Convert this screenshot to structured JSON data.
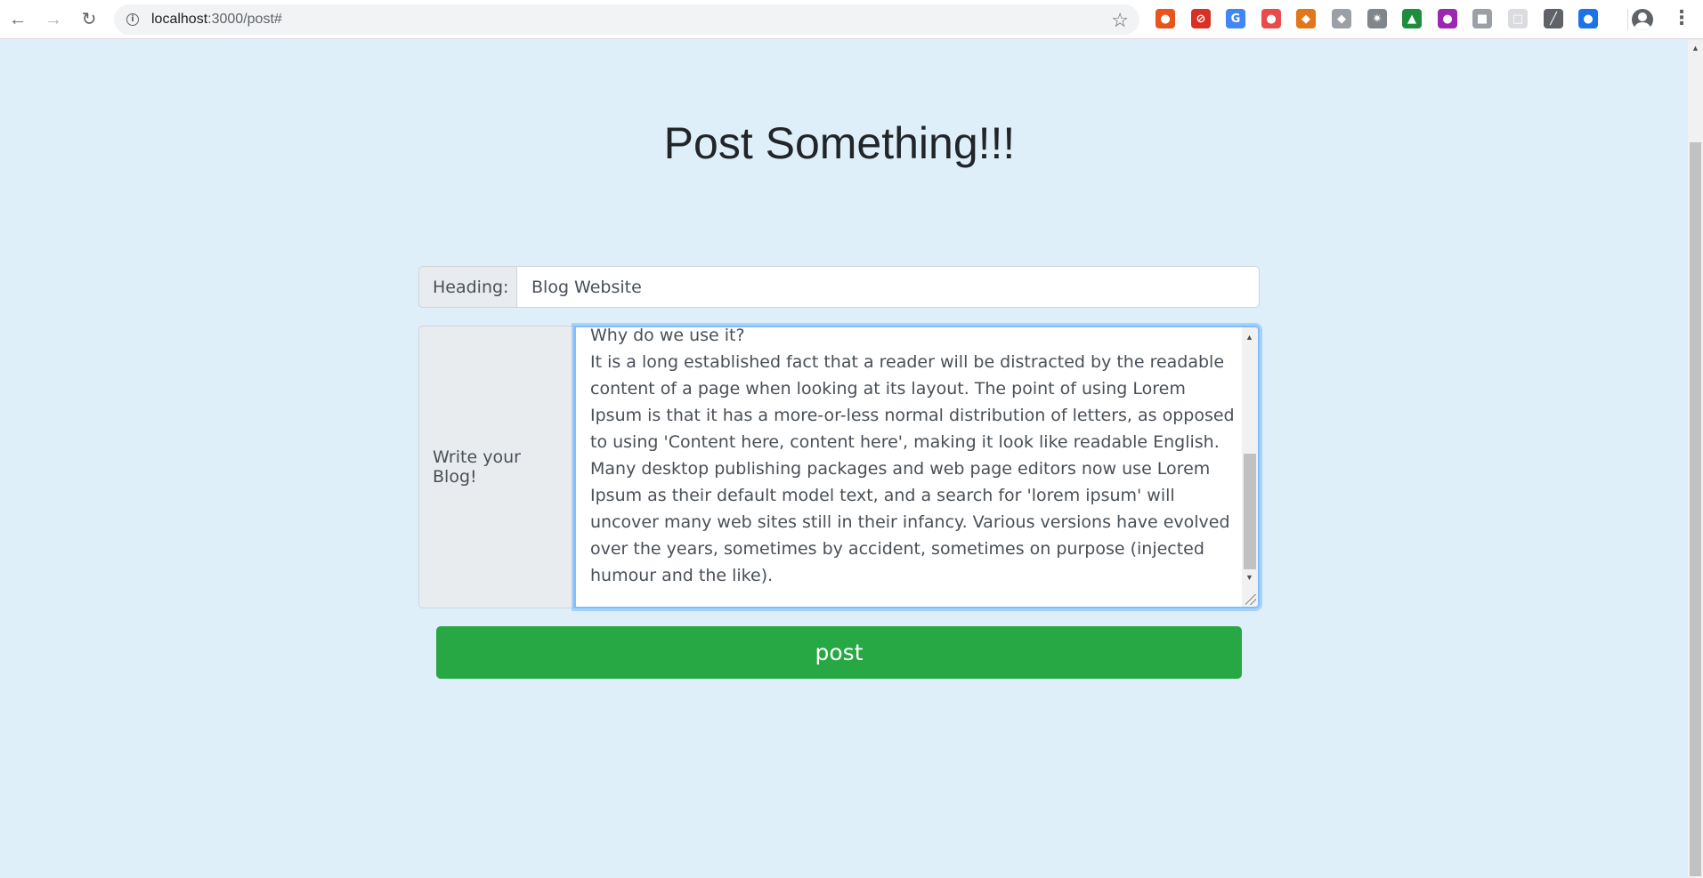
{
  "browser": {
    "url_host": "localhost",
    "url_path": ":3000/post#",
    "extensions": [
      {
        "name": "fire-extension-icon",
        "glyph": "●",
        "color": "#e8541a"
      },
      {
        "name": "blocker-extension-icon",
        "glyph": "⊘",
        "color": "#d93025"
      },
      {
        "name": "translate-extension-icon",
        "glyph": "G",
        "color": "#4285f4"
      },
      {
        "name": "red-circle-extension-icon",
        "glyph": "●",
        "color": "#e94b4b"
      },
      {
        "name": "fox-extension-icon",
        "glyph": "◆",
        "color": "#e2761b"
      },
      {
        "name": "shield-extension-icon",
        "glyph": "◆",
        "color": "#9aa0a6"
      },
      {
        "name": "bug-extension-icon",
        "glyph": "✷",
        "color": "#80868b"
      },
      {
        "name": "html-extension-icon",
        "glyph": "▲",
        "color": "#1e8e3e"
      },
      {
        "name": "purple-extension-icon",
        "glyph": "●",
        "color": "#9c27b0"
      },
      {
        "name": "image-extension-icon",
        "glyph": "■",
        "color": "#9aa0a6"
      },
      {
        "name": "grey-extension-icon",
        "glyph": "□",
        "color": "#dadce0"
      },
      {
        "name": "eyedropper-extension-icon",
        "glyph": "╱",
        "color": "#5f6368"
      },
      {
        "name": "droplet-extension-icon",
        "glyph": "●",
        "color": "#1a73e8"
      }
    ]
  },
  "page": {
    "title": "Post Something!!!",
    "heading_label": "Heading:",
    "heading_value": "Blog Website",
    "blog_label": "Write your Blog!",
    "blog_value": "Why do we use it?\nIt is a long established fact that a reader will be distracted by the readable content of a page when looking at its layout. The point of using Lorem Ipsum is that it has a more-or-less normal distribution of letters, as opposed to using 'Content here, content here', making it look like readable English. Many desktop publishing packages and web page editors now use Lorem Ipsum as their default model text, and a search for 'lorem ipsum' will uncover many web sites still in their infancy. Various versions have evolved over the years, sometimes by accident, sometimes on purpose (injected humour and the like).",
    "post_button_label": "post"
  },
  "colors": {
    "page_background": "#dfeff9",
    "post_button": "#28a745",
    "focus_border": "#80bdff"
  }
}
